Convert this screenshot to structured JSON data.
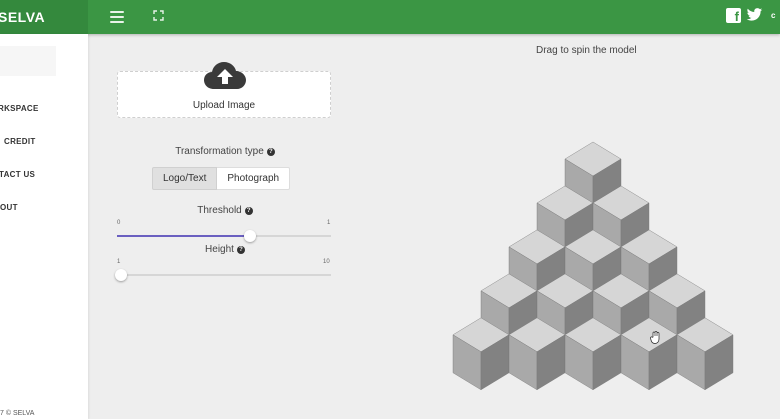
{
  "app": {
    "brand": "SELVA"
  },
  "topbar": {
    "menu_icon": "hamburger-icon",
    "fullscreen_icon": "fullscreen-icon",
    "social": [
      "facebook-icon",
      "twitter-icon"
    ],
    "more_text": "c"
  },
  "sidebar": {
    "items": [
      {
        "label": "RKSPACE"
      },
      {
        "label": "CREDIT"
      },
      {
        "label": "TACT US"
      },
      {
        "label": "OUT"
      }
    ],
    "footer": "7 © SELVA"
  },
  "upload": {
    "label": "Upload Image",
    "icon": "cloud-upload-icon"
  },
  "transformation": {
    "label": "Transformation type",
    "options": [
      "Logo/Text",
      "Photograph"
    ],
    "selected": "Logo/Text"
  },
  "threshold": {
    "label": "Threshold",
    "min": "0",
    "max": "1",
    "value_fraction": 0.62
  },
  "height": {
    "label": "Height",
    "min": "1",
    "max": "10",
    "value_fraction": 0.02
  },
  "viewer": {
    "hint": "Drag to spin the model",
    "pyramid_rows": 5
  },
  "colors": {
    "topbar": "#3b9644",
    "accent_slider": "#6a5fc0",
    "background": "#eeeeee"
  }
}
